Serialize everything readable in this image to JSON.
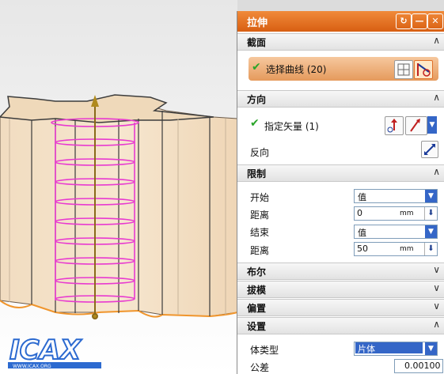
{
  "window": {
    "title": "拉伸"
  },
  "sections": {
    "section": {
      "label": "截面"
    },
    "direction": {
      "label": "方向"
    },
    "limits": {
      "label": "限制"
    },
    "boolean": {
      "label": "布尔"
    },
    "draft": {
      "label": "拔模"
    },
    "offset": {
      "label": "偏置"
    },
    "settings": {
      "label": "设置"
    }
  },
  "section": {
    "select_curve": "选择曲线 (20)"
  },
  "direction": {
    "specify_vector": "指定矢量 (1)",
    "reverse": "反向"
  },
  "limits": {
    "start_label": "开始",
    "start_value": "值",
    "start_distance_label": "距离",
    "start_distance": "0",
    "start_unit": "mm",
    "end_label": "结束",
    "end_value": "值",
    "end_distance_label": "距离",
    "end_distance": "50",
    "end_unit": "mm"
  },
  "settings": {
    "body_type_label": "体类型",
    "body_type": "片体",
    "tolerance_label": "公差",
    "tolerance": "0.00100"
  },
  "logo": {
    "text": "ICAX",
    "url": "WWW.ICAX.ORG"
  },
  "colors": {
    "title_orange": "#e06a1c",
    "helix_magenta": "#e83ad0",
    "accent_blue": "#3466c7"
  }
}
